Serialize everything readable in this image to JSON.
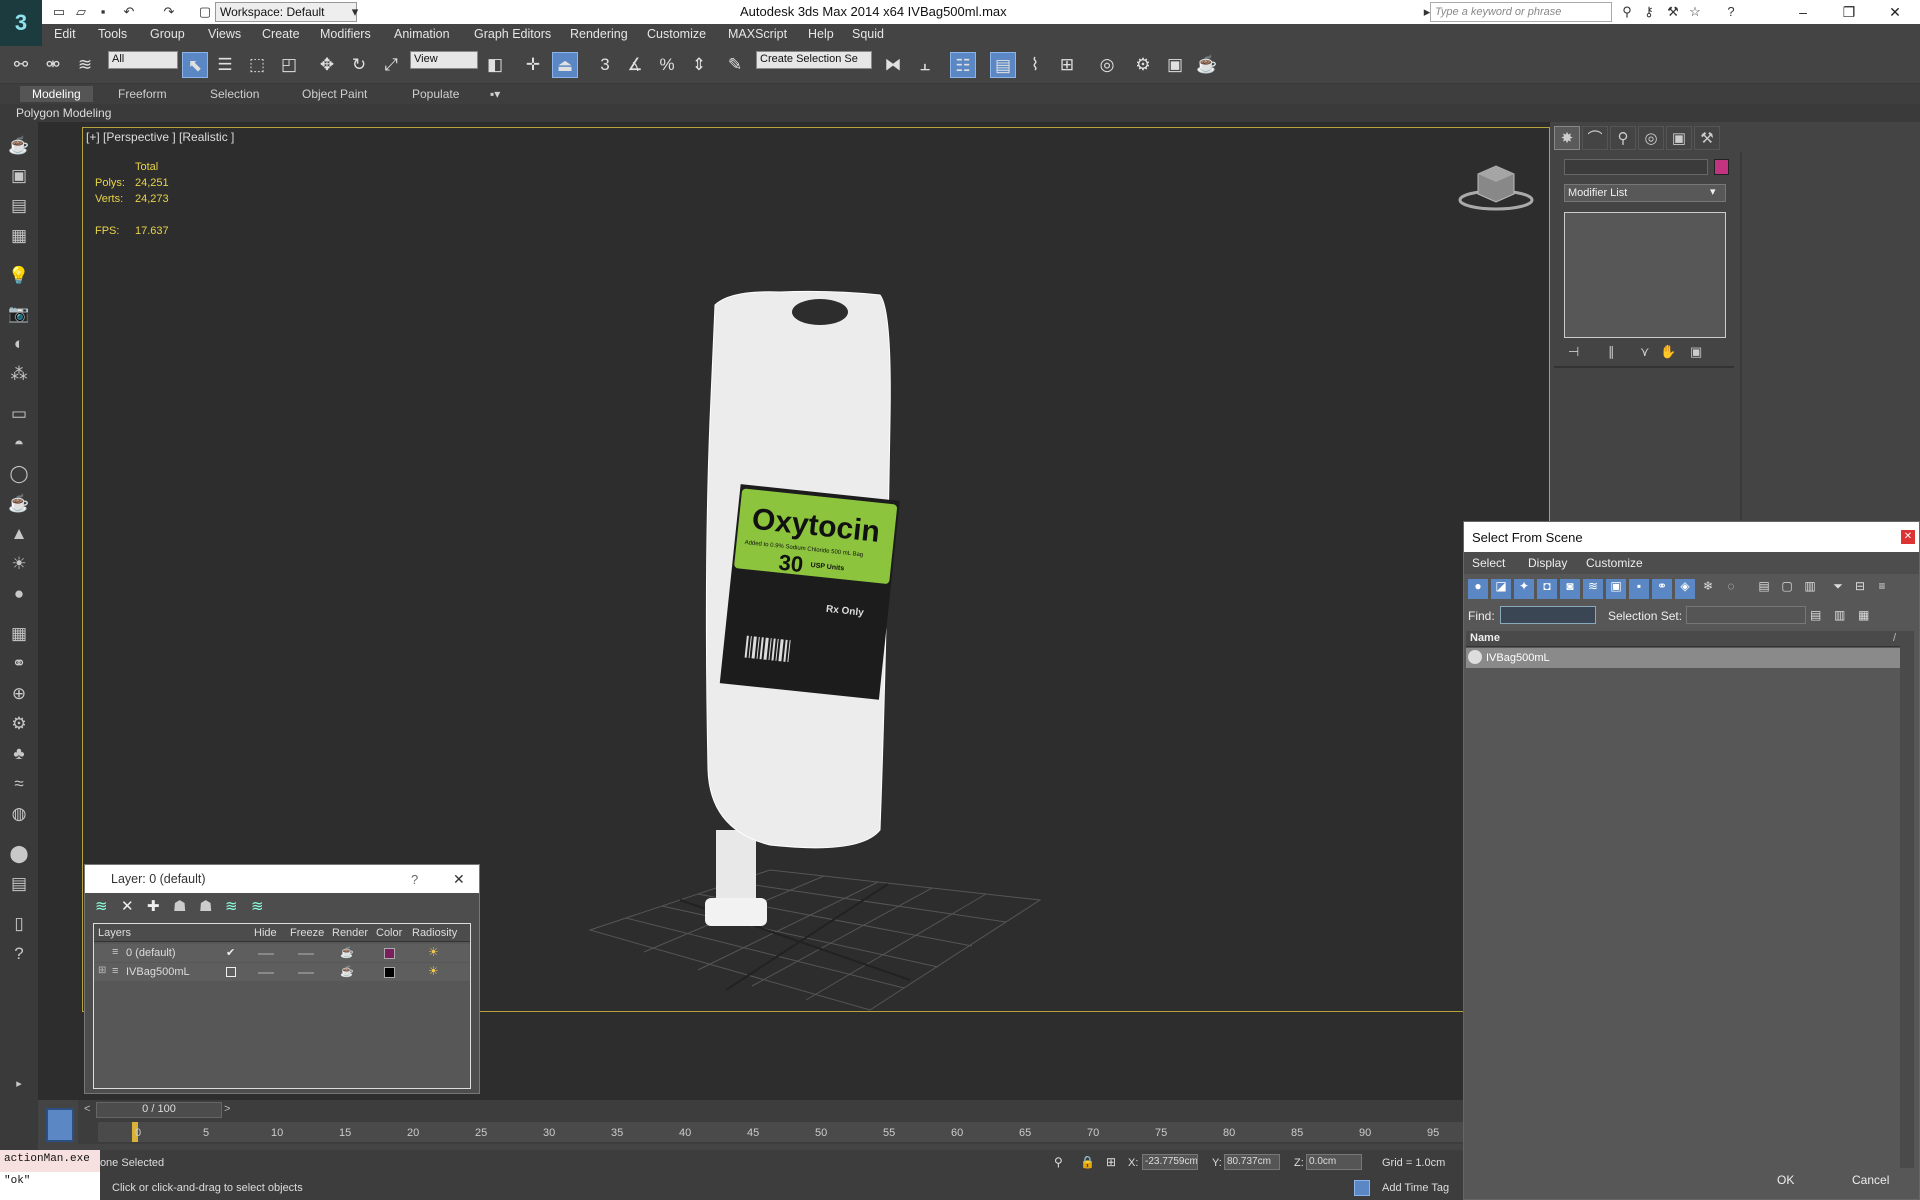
{
  "app": {
    "title": "Autodesk 3ds Max  2014 x64     IVBag500ml.max",
    "workspace": "Workspace: Default",
    "search_placeholder": "Type a keyword or phrase",
    "logo": "3"
  },
  "menus": [
    "Edit",
    "Tools",
    "Group",
    "Views",
    "Create",
    "Modifiers",
    "Animation",
    "Graph Editors",
    "Rendering",
    "Customize",
    "MAXScript",
    "Help",
    "Squid"
  ],
  "toolbar": {
    "filter": "All",
    "ref_coord": "View",
    "selection_set": "Create Selection Se",
    "snap": "3",
    "percent": "%"
  },
  "ribbon": {
    "tabs": [
      "Modeling",
      "Freeform",
      "Selection",
      "Object Paint",
      "Populate"
    ],
    "panel": "Polygon Modeling"
  },
  "viewport": {
    "label": "[+] [Perspective ] [Realistic ]",
    "stats_header": "Total",
    "polys_label": "Polys:",
    "polys_value": "24,251",
    "verts_label": "Verts:",
    "verts_value": "24,273",
    "fps_label": "FPS:",
    "fps_value": "17.637",
    "bag_title": "Oxytocin",
    "bag_sub": "Added to 0.9% Sodium Chloride 500 mL Bag",
    "bag_dose": "30",
    "bag_units": "USP Units",
    "bag_rx": "Rx Only"
  },
  "command_panel": {
    "modifier_list": "Modifier List",
    "color_swatch": "#c2347f"
  },
  "select_from_scene": {
    "title": "Select From Scene",
    "menus": [
      "Select",
      "Display",
      "Customize"
    ],
    "find_label": "Find:",
    "selection_set_label": "Selection Set:",
    "column_name": "Name",
    "sort_indicator": "/",
    "items": [
      "IVBag500mL"
    ],
    "ok": "OK",
    "cancel": "Cancel"
  },
  "layer_dialog": {
    "title": "Layer: 0 (default)",
    "help": "?",
    "columns": [
      "Layers",
      "Hide",
      "Freeze",
      "Render",
      "Color",
      "Radiosity"
    ],
    "rows": [
      {
        "name": "0 (default)",
        "color": "#7a1f5c"
      },
      {
        "name": "IVBag500mL",
        "color": "#000000"
      }
    ]
  },
  "timeline": {
    "frame": "0 / 100",
    "ticks": [
      "0",
      "5",
      "10",
      "15",
      "20",
      "25",
      "30",
      "35",
      "40",
      "45",
      "50",
      "55",
      "60",
      "65",
      "70",
      "75",
      "80",
      "85",
      "90",
      "95"
    ]
  },
  "status": {
    "selection": "None Selected",
    "prompt": "Click or click-and-drag to select objects",
    "x_label": "X:",
    "x_value": "-23.7759cm",
    "y_label": "Y:",
    "y_value": "80.737cm",
    "z_label": "Z:",
    "z_value": "0.0cm",
    "grid": "Grid = 1.0cm",
    "add_time_tag": "Add Time Tag"
  },
  "maxscript_listener": {
    "line1": "actionMan.exe",
    "line2": "\"ok\""
  }
}
